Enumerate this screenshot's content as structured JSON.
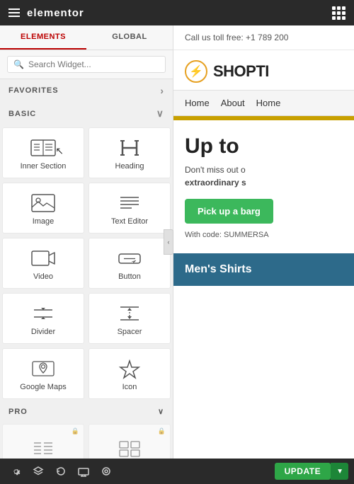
{
  "topbar": {
    "title": "elementor",
    "call_text": "Call us toll free: +1 789 200"
  },
  "panel": {
    "tabs": [
      {
        "label": "ELEMENTS",
        "active": true
      },
      {
        "label": "GLOBAL",
        "active": false
      }
    ],
    "search_placeholder": "Search Widget...",
    "favorites_label": "FAVORITES",
    "basic_label": "BASIC",
    "pro_label": "PRO",
    "widgets": [
      {
        "label": "Inner Section",
        "icon": "inner-section-icon",
        "pro": false
      },
      {
        "label": "Heading",
        "icon": "heading-icon",
        "pro": false
      },
      {
        "label": "Image",
        "icon": "image-icon",
        "pro": false
      },
      {
        "label": "Text Editor",
        "icon": "text-editor-icon",
        "pro": false
      },
      {
        "label": "Video",
        "icon": "video-icon",
        "pro": false
      },
      {
        "label": "Button",
        "icon": "button-icon",
        "pro": false
      },
      {
        "label": "Divider",
        "icon": "divider-icon",
        "pro": false
      },
      {
        "label": "Spacer",
        "icon": "spacer-icon",
        "pro": false
      },
      {
        "label": "Google Maps",
        "icon": "google-maps-icon",
        "pro": false
      },
      {
        "label": "Icon",
        "icon": "icon-widget-icon",
        "pro": false
      }
    ],
    "pro_widgets": [
      {
        "label": "",
        "icon": "pro-widget-1",
        "pro": true
      },
      {
        "label": "",
        "icon": "pro-widget-2",
        "pro": true
      }
    ]
  },
  "toolbar": {
    "update_label": "UPDATE",
    "settings_title": "Settings"
  },
  "preview": {
    "topbar_text": "Call us toll free: +1 789 200",
    "logo_text": "SHOPTI",
    "logo_symbol": "⚡",
    "nav_items": [
      "Home",
      "About",
      "Home"
    ],
    "hero_title": "Up to",
    "hero_subtitle_1": "Don't miss out o",
    "hero_subtitle_2": "extraordinary s",
    "hero_button": "Pick up a barg",
    "hero_code": "With code: SUMMERSA",
    "product_banner": "Men's Shirts"
  }
}
